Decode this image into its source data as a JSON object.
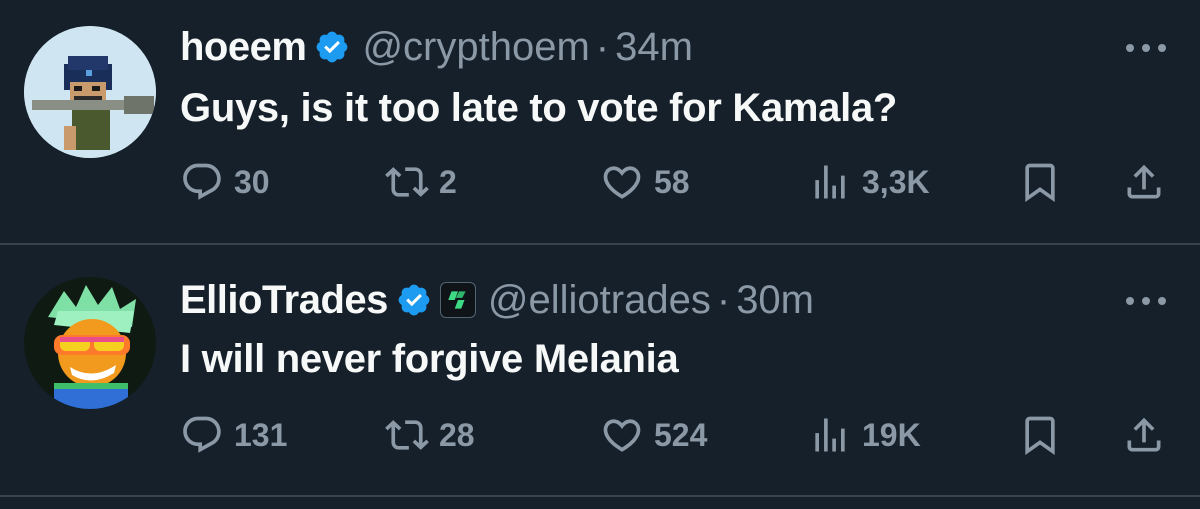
{
  "tweets": [
    {
      "name": "hoeem",
      "handle": "@crypthoem",
      "separator": "·",
      "time": "34m",
      "text": "Guys, is it too late to vote for Kamala?",
      "replies": "30",
      "reposts": "2",
      "likes": "58",
      "views": "3,3K",
      "avatar_icon": "pixel-art-avatar-icon"
    },
    {
      "name": "EllioTrades",
      "handle": "@elliotrades",
      "separator": "·",
      "time": "30m",
      "text": "I will never forgive Melania",
      "replies": "131",
      "reposts": "28",
      "likes": "524",
      "views": "19K",
      "avatar_icon": "cartoon-orange-avatar-icon"
    }
  ],
  "colors": {
    "background": "#15202b",
    "verified": "#1d9bf0",
    "muted": "#8b98a5",
    "text": "#f7f9f9",
    "divider": "#38444d"
  }
}
